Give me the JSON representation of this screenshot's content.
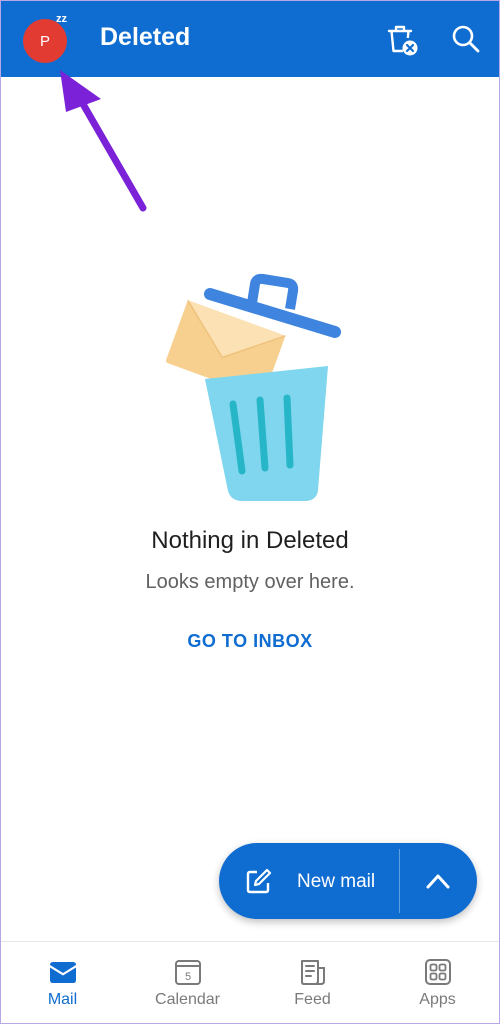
{
  "header": {
    "avatar_initial": "P",
    "avatar_status": "zz",
    "title": "Deleted",
    "actions": [
      {
        "icon": "empty-trash-icon"
      },
      {
        "icon": "search-icon"
      }
    ]
  },
  "empty_state": {
    "illustration": "trash-with-envelope",
    "title": "Nothing in Deleted",
    "subtitle": "Looks empty over here.",
    "action": "GO TO INBOX"
  },
  "fab": {
    "label": "New mail",
    "compose_icon": "compose-icon",
    "expand_icon": "chevron-up-icon"
  },
  "bottom_nav": {
    "items": [
      {
        "label": "Mail",
        "icon": "mail-icon",
        "active": true
      },
      {
        "label": "Calendar",
        "icon": "calendar-icon",
        "badge": "5",
        "active": false
      },
      {
        "label": "Feed",
        "icon": "feed-icon",
        "active": false
      },
      {
        "label": "Apps",
        "icon": "apps-icon",
        "active": false
      }
    ]
  },
  "colors": {
    "accent": "#0f6cd0",
    "avatar": "#e23c32",
    "annotation_arrow": "#7b22d8",
    "trash_can": "#7fd6ee",
    "trash_lid": "#3f84df",
    "envelope": "#f7d08f"
  }
}
